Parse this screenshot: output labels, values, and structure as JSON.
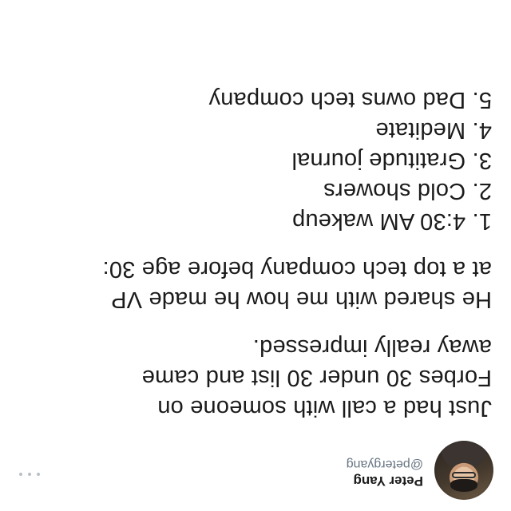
{
  "tweet": {
    "author": {
      "display_name": "Peter Yang",
      "handle": "@petergyang"
    },
    "more_menu_icon": "ellipsis-icon",
    "intro_lines": [
      "Just had a call with someone on",
      "Forbes 30 under 30 list and came",
      "away really impressed."
    ],
    "shared_lines": [
      "He shared with me how he made VP",
      "at a top tech company before age 30:"
    ],
    "list_items": [
      "1. 4:30 AM wakeup",
      "2. Cold showers",
      "3. Gratitude journal",
      "4. Meditate",
      "5. Dad owns tech company"
    ]
  }
}
